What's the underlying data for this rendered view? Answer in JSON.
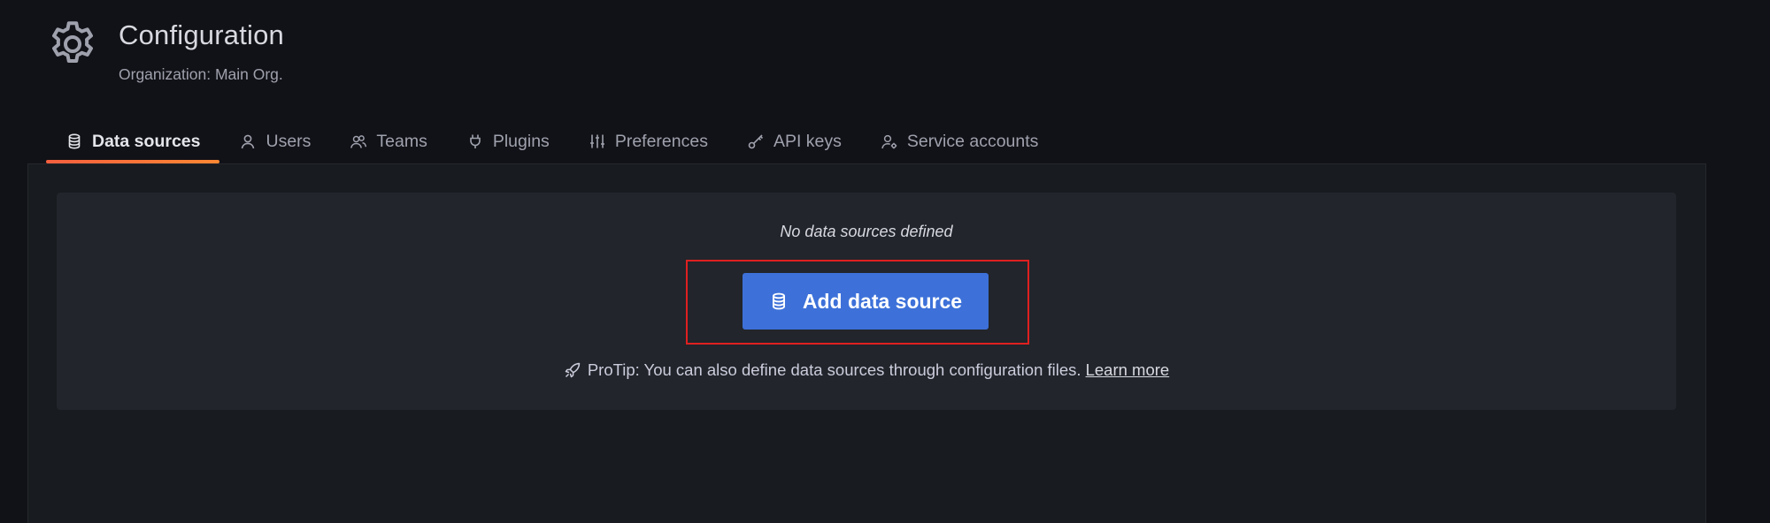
{
  "header": {
    "title": "Configuration",
    "subtitle": "Organization: Main Org.",
    "icon": "gear-icon"
  },
  "tabs": [
    {
      "label": "Data sources",
      "icon": "database-icon",
      "active": true
    },
    {
      "label": "Users",
      "icon": "user-icon",
      "active": false
    },
    {
      "label": "Teams",
      "icon": "users-icon",
      "active": false
    },
    {
      "label": "Plugins",
      "icon": "plug-icon",
      "active": false
    },
    {
      "label": "Preferences",
      "icon": "sliders-icon",
      "active": false
    },
    {
      "label": "API keys",
      "icon": "key-icon",
      "active": false
    },
    {
      "label": "Service accounts",
      "icon": "user-cog-icon",
      "active": false
    }
  ],
  "empty_state": {
    "message": "No data sources defined",
    "button_label": "Add data source",
    "protip_text": "ProTip: You can also define data sources through configuration files.",
    "learn_more": "Learn more"
  },
  "colors": {
    "accent_button": "#3d71d9",
    "active_tab_underline": "#f55f3e",
    "highlight_border": "#e02020",
    "background": "#111217"
  }
}
